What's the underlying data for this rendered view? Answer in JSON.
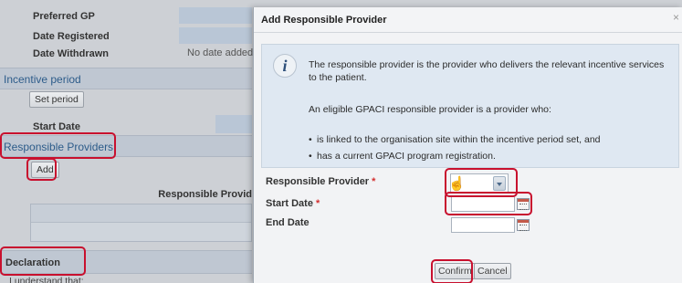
{
  "background": {
    "fields": {
      "preferred_gp": "Preferred GP",
      "date_registered": "Date Registered",
      "date_withdrawn": "Date Withdrawn",
      "no_date_added": "No date added"
    },
    "incentive_period": {
      "title": "Incentive period",
      "set_period_button": "Set period",
      "start_date": "Start Date"
    },
    "responsible_providers": {
      "title": "Responsible Providers",
      "add_button": "Add",
      "column_header": "Responsible Provid"
    },
    "declaration": {
      "title": "Declaration",
      "text": "I understand that:"
    }
  },
  "modal": {
    "title": "Add Responsible Provider",
    "close_glyph": "×",
    "info": {
      "icon": "i",
      "paragraph1": "The responsible provider is the provider who delivers the relevant incentive services to the patient.",
      "paragraph2": "An eligible GPACI responsible provider is a provider who:",
      "bullets": [
        "is linked to the organisation site within the incentive period set, and",
        "has a current GPACI program registration."
      ]
    },
    "form": {
      "responsible_provider_label": "Responsible Provider",
      "start_date_label": "Start Date",
      "end_date_label": "End Date",
      "required_marker": "*",
      "responsible_provider_value": "",
      "start_date_value": "",
      "end_date_value": ""
    },
    "buttons": {
      "confirm": "Confirm",
      "cancel": "Cancel"
    }
  },
  "colors": {
    "highlight": "#c8102e",
    "section_title": "#2d5c8a",
    "required": "#d32f2f"
  }
}
